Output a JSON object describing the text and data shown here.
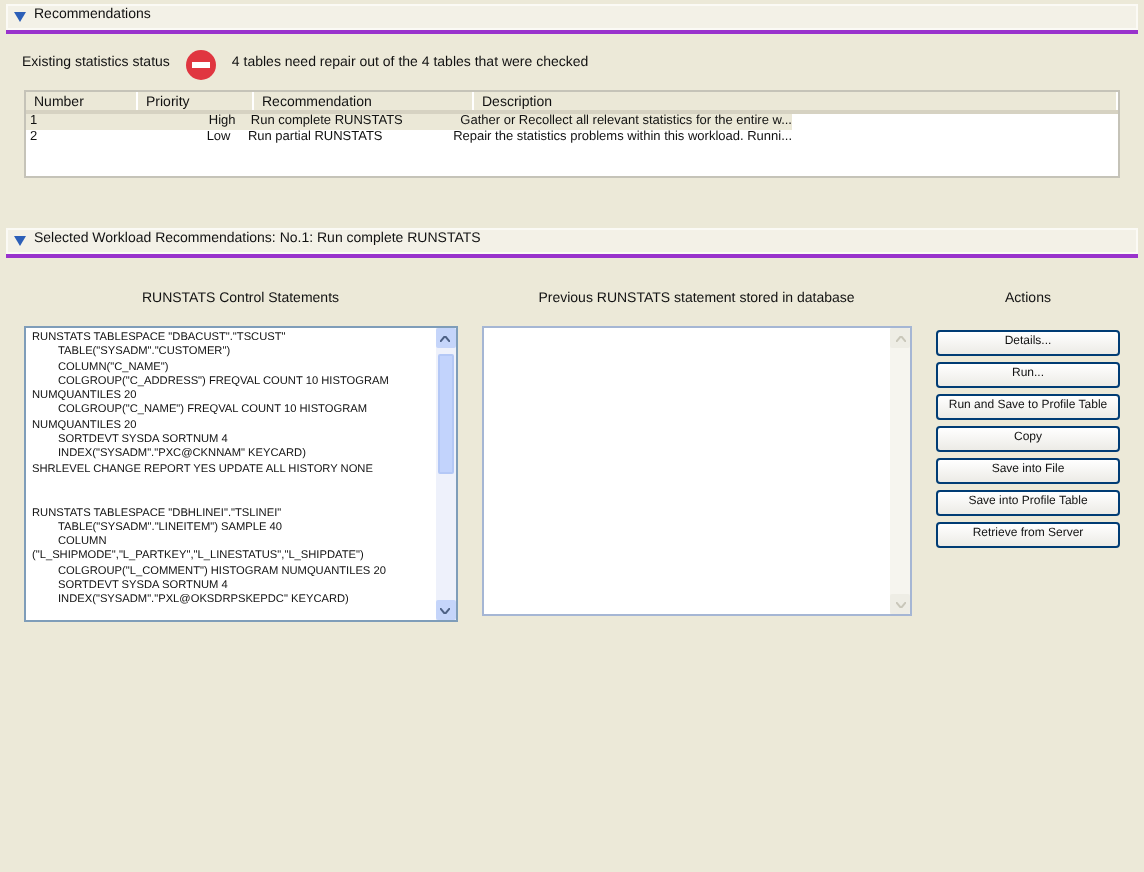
{
  "recommendations_section": {
    "title": "Recommendations",
    "expanded": true,
    "status_label": "Existing statistics status",
    "status_message": "4 tables need repair out of the 4 tables that were checked",
    "table": {
      "columns": [
        "Number",
        "Priority",
        "Recommendation",
        "Description"
      ],
      "rows": [
        {
          "cells": [
            "1",
            "High",
            "Run complete RUNSTATS",
            "Gather or Recollect all relevant statistics for the entire w..."
          ],
          "selected": true
        },
        {
          "cells": [
            "2",
            "Low",
            "Run partial RUNSTATS",
            "Repair the statistics problems within this workload. Runni..."
          ],
          "selected": false
        }
      ]
    }
  },
  "details_section": {
    "title": "Selected Workload Recommendations: No.1: Run complete RUNSTATS",
    "expanded": true,
    "control_statements": {
      "title": "RUNSTATS Control Statements",
      "statements": [
        {
          "lines": [
            {
              "text": "RUNSTATS TABLESPACE \"DBACUST\".\"TSCUST\"",
              "indented": false
            },
            {
              "text": "TABLE(\"SYSADM\".\"CUSTOMER\")",
              "indented": true
            },
            {
              "text": "COLUMN(\"C_NAME\")",
              "indented": true
            },
            {
              "text": "COLGROUP(\"C_ADDRESS\") FREQVAL COUNT 10 HISTOGRAM",
              "indented": true
            },
            {
              "text": "NUMQUANTILES 20",
              "indented": false
            },
            {
              "text": "COLGROUP(\"C_NAME\") FREQVAL COUNT 10 HISTOGRAM",
              "indented": true
            },
            {
              "text": "NUMQUANTILES 20",
              "indented": false
            },
            {
              "text": "SORTDEVT SYSDA SORTNUM 4",
              "indented": true
            },
            {
              "text": "INDEX(\"SYSADM\".\"PXC@CKNNAM\" KEYCARD)",
              "indented": true
            },
            {
              "text": "SHRLEVEL CHANGE REPORT YES UPDATE ALL HISTORY NONE",
              "indented": false
            }
          ]
        },
        {
          "lines": [
            {
              "text": "RUNSTATS TABLESPACE \"DBHLINEI\".\"TSLINEI\"",
              "indented": false
            },
            {
              "text": "TABLE(\"SYSADM\".\"LINEITEM\") SAMPLE 40",
              "indented": true
            },
            {
              "text": "COLUMN",
              "indented": true
            },
            {
              "text": "(\"L_SHIPMODE\",\"L_PARTKEY\",\"L_LINESTATUS\",\"L_SHIPDATE\")",
              "indented": false
            },
            {
              "text": "COLGROUP(\"L_COMMENT\") HISTOGRAM NUMQUANTILES 20",
              "indented": true
            },
            {
              "text": "SORTDEVT SYSDA SORTNUM 4",
              "indented": true
            },
            {
              "text": "INDEX(\"SYSADM\".\"PXL@OKSDRPSKEPDC\" KEYCARD)",
              "indented": true
            }
          ]
        }
      ]
    },
    "previous_statements": {
      "title": "Previous RUNSTATS statement stored in database"
    },
    "actions": {
      "title": "Actions",
      "buttons": [
        "Details...",
        "Run...",
        "Run and Save to Profile Table",
        "Copy",
        "Save into File",
        "Save into Profile Table",
        "Retrieve from Server"
      ]
    }
  }
}
